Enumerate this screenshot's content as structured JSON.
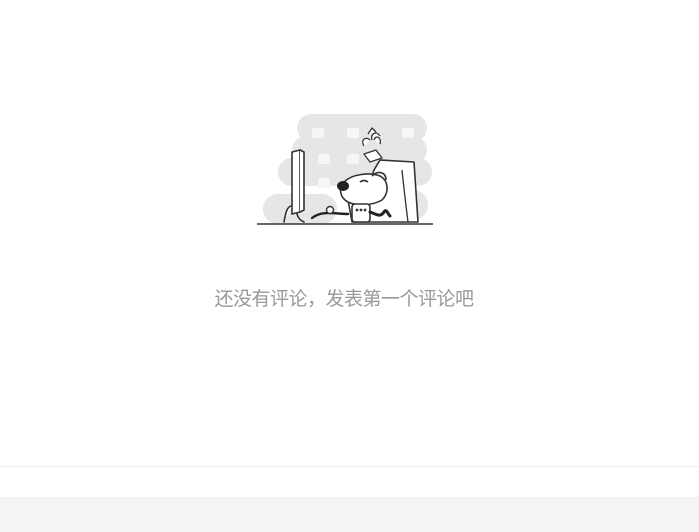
{
  "comments": {
    "empty_message": "还没有评论，发表第一个评论吧",
    "illustration_icon": "no-comments-dog-at-computer-illustration"
  },
  "colors": {
    "background": "#ffffff",
    "message_text": "#999999",
    "illustration_blob": "#e6e6e6",
    "illustration_line": "#333333",
    "divider": "#ececec",
    "footer_band": "#f4f4f4"
  }
}
